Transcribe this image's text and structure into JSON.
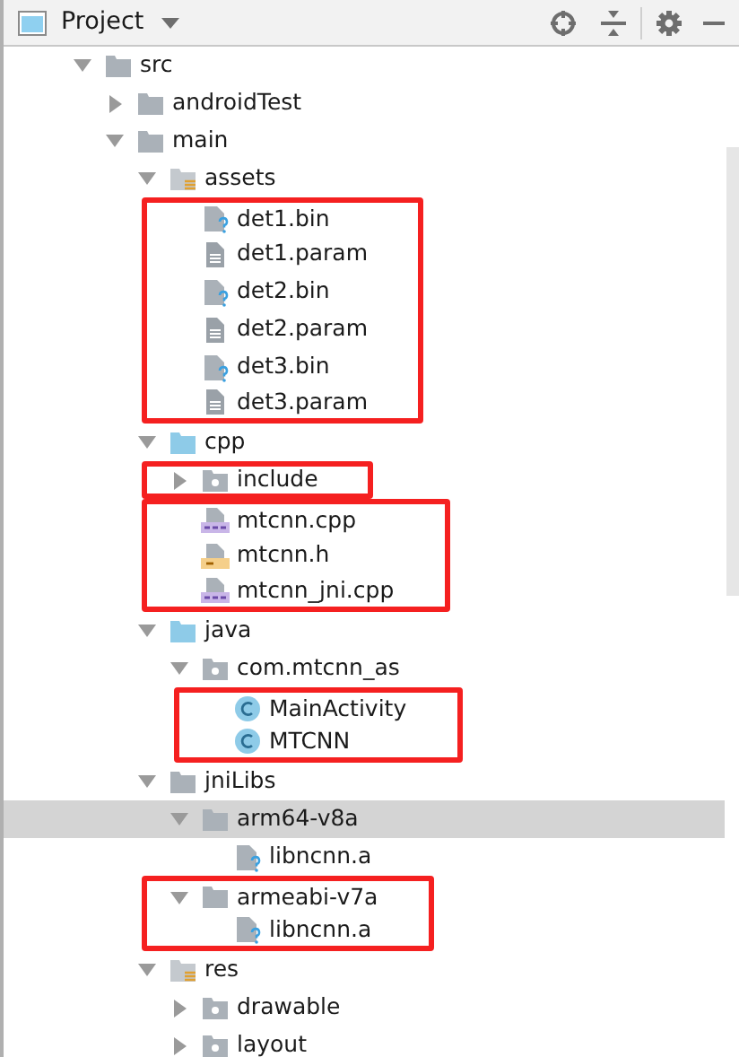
{
  "panel": {
    "title": "Project"
  },
  "tree": [
    {
      "kind": "folder",
      "label": "src",
      "expanded": true,
      "selected": false,
      "children": [
        {
          "kind": "folder",
          "label": "androidTest",
          "expanded": false,
          "selected": false
        },
        {
          "kind": "folder",
          "label": "main",
          "expanded": true,
          "selected": false,
          "children": [
            {
              "kind": "resource-folder",
              "label": "assets",
              "expanded": true,
              "selected": false,
              "children": [
                {
                  "kind": "callout",
                  "children": [
                    {
                      "kind": "binary-file",
                      "label": "det1.bin",
                      "selected": false
                    },
                    {
                      "kind": "text-file",
                      "label": "det1.param",
                      "selected": false
                    },
                    {
                      "kind": "binary-file",
                      "label": "det2.bin",
                      "selected": false
                    },
                    {
                      "kind": "text-file",
                      "label": "det2.param",
                      "selected": false
                    },
                    {
                      "kind": "binary-file",
                      "label": "det3.bin",
                      "selected": false
                    },
                    {
                      "kind": "text-file",
                      "label": "det3.param",
                      "selected": false
                    }
                  ]
                }
              ]
            },
            {
              "kind": "source-folder",
              "label": "cpp",
              "expanded": true,
              "selected": false,
              "children": [
                {
                  "kind": "callout",
                  "children": [
                    {
                      "kind": "package",
                      "label": "include",
                      "expanded": false,
                      "selected": false
                    }
                  ]
                },
                {
                  "kind": "callout",
                  "children": [
                    {
                      "kind": "cpp-file",
                      "label": "mtcnn.cpp",
                      "selected": false
                    },
                    {
                      "kind": "header-file",
                      "label": "mtcnn.h",
                      "selected": false
                    },
                    {
                      "kind": "cpp-file",
                      "label": "mtcnn_jni.cpp",
                      "selected": false
                    }
                  ]
                }
              ]
            },
            {
              "kind": "source-folder",
              "label": "java",
              "expanded": true,
              "selected": false,
              "children": [
                {
                  "kind": "package",
                  "label": "com.mtcnn_as",
                  "expanded": true,
                  "selected": false,
                  "children": [
                    {
                      "kind": "callout",
                      "children": [
                        {
                          "kind": "class",
                          "label": "MainActivity",
                          "selected": false
                        },
                        {
                          "kind": "class",
                          "label": "MTCNN",
                          "selected": false
                        }
                      ]
                    }
                  ]
                }
              ]
            },
            {
              "kind": "folder",
              "label": "jniLibs",
              "expanded": true,
              "selected": false,
              "children": [
                {
                  "kind": "folder",
                  "label": "arm64-v8a",
                  "expanded": true,
                  "selected": true,
                  "children": [
                    {
                      "kind": "binary-file",
                      "label": "libncnn.a",
                      "selected": false
                    }
                  ]
                },
                {
                  "kind": "callout",
                  "children": [
                    {
                      "kind": "folder",
                      "label": "armeabi-v7a",
                      "expanded": true,
                      "selected": false,
                      "children": [
                        {
                          "kind": "binary-file",
                          "label": "libncnn.a",
                          "selected": false
                        }
                      ]
                    }
                  ]
                }
              ]
            },
            {
              "kind": "resource-folder",
              "label": "res",
              "expanded": true,
              "selected": false,
              "children": [
                {
                  "kind": "package",
                  "label": "drawable",
                  "expanded": false,
                  "selected": false
                },
                {
                  "kind": "package",
                  "label": "layout",
                  "expanded": false,
                  "selected": false
                }
              ]
            }
          ]
        }
      ]
    }
  ]
}
